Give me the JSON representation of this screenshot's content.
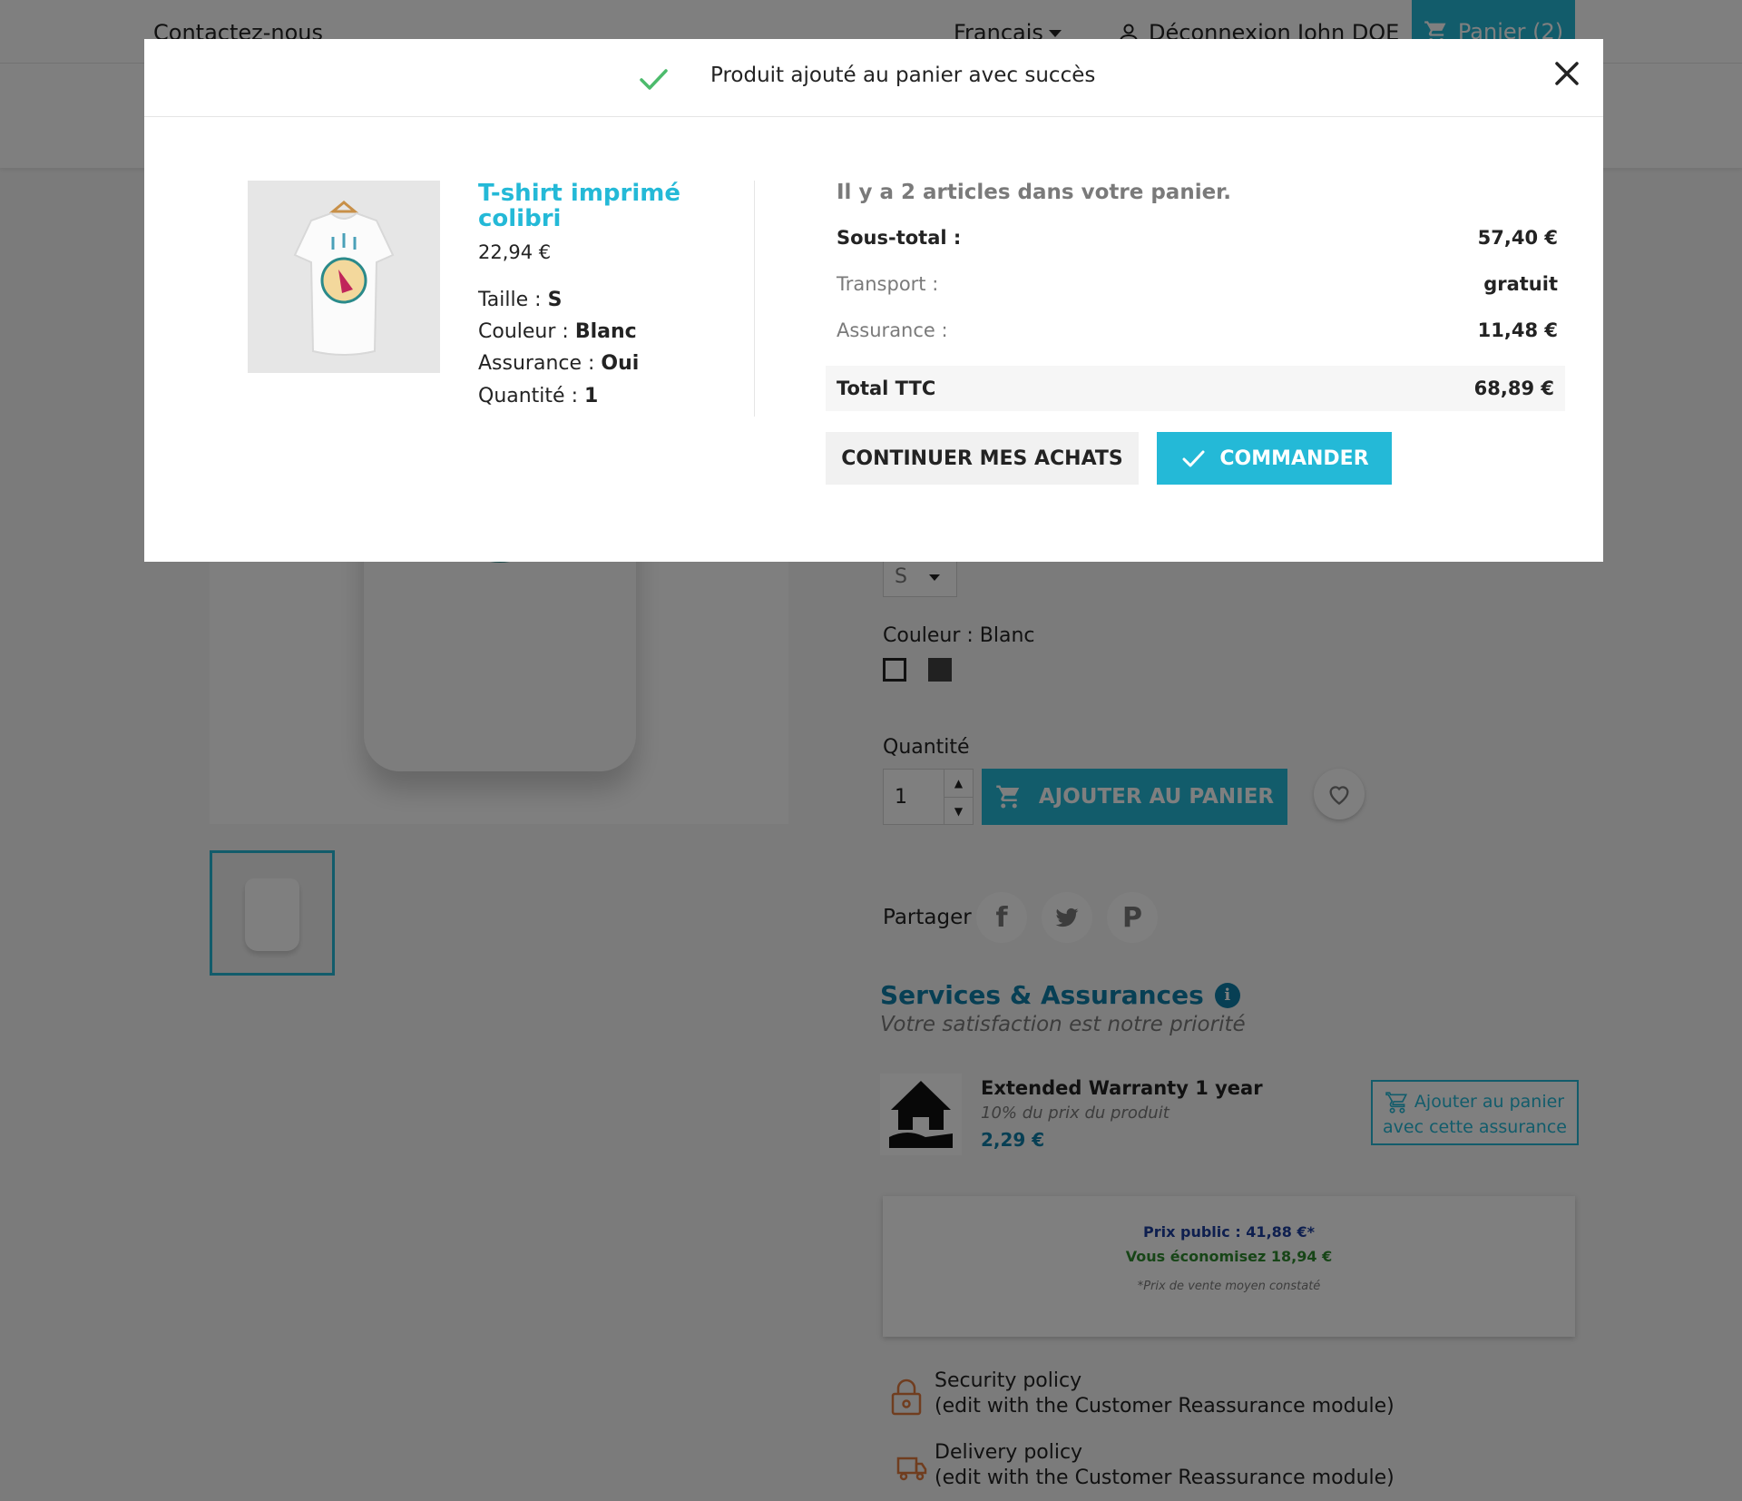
{
  "header": {
    "contact": "Contactez-nous",
    "language": "Français",
    "logout": "Déconnexion",
    "user": "John DOE",
    "cart": "Panier (2)"
  },
  "product_page": {
    "size_value": "S",
    "color_label": "Couleur : Blanc",
    "quantity_label": "Quantité",
    "quantity_value": "1",
    "add_to_cart": "AJOUTER AU PANIER",
    "share_label": "Partager",
    "services_title": "Services & Assurances",
    "services_subtitle": "Votre satisfaction est notre priorité",
    "warranty_title": "Extended Warranty 1 year",
    "warranty_desc": "10% du prix du produit",
    "warranty_price": "2,29 €",
    "warranty_button": "Ajouter au panier avec cette assurance",
    "public_price": "Prix public : 41,88 €*",
    "savings": "Vous économisez 18,94 €",
    "price_note": "*Prix de vente moyen constaté",
    "security_title": "Security policy",
    "security_sub": "(edit with the Customer Reassurance module)",
    "delivery_title": "Delivery policy",
    "delivery_sub": "(edit with the Customer Reassurance module)"
  },
  "modal": {
    "title": "Produit ajouté au panier avec succès",
    "product": {
      "name": "T-shirt imprimé colibri",
      "price": "22,94 €",
      "attributes": [
        {
          "label": "Taille : ",
          "value": "S"
        },
        {
          "label": "Couleur : ",
          "value": "Blanc"
        },
        {
          "label": "Assurance : ",
          "value": "Oui"
        },
        {
          "label": "Quantité : ",
          "value": "1"
        }
      ]
    },
    "cart": {
      "count_text": "Il y a 2 articles dans votre panier.",
      "subtotal_label": "Sous-total :",
      "subtotal_value": "57,40 €",
      "shipping_label": "Transport :",
      "shipping_value": "gratuit",
      "insurance_label": "Assurance :",
      "insurance_value": "11,48 €",
      "total_label": "Total TTC",
      "total_value": "68,89 €"
    },
    "buttons": {
      "continue": "CONTINUER MES ACHATS",
      "order": "COMMANDER"
    }
  },
  "colors": {
    "accent": "#24b9d7",
    "success_check": "#4cbb6c",
    "services_blue": "#0f7fa8"
  }
}
